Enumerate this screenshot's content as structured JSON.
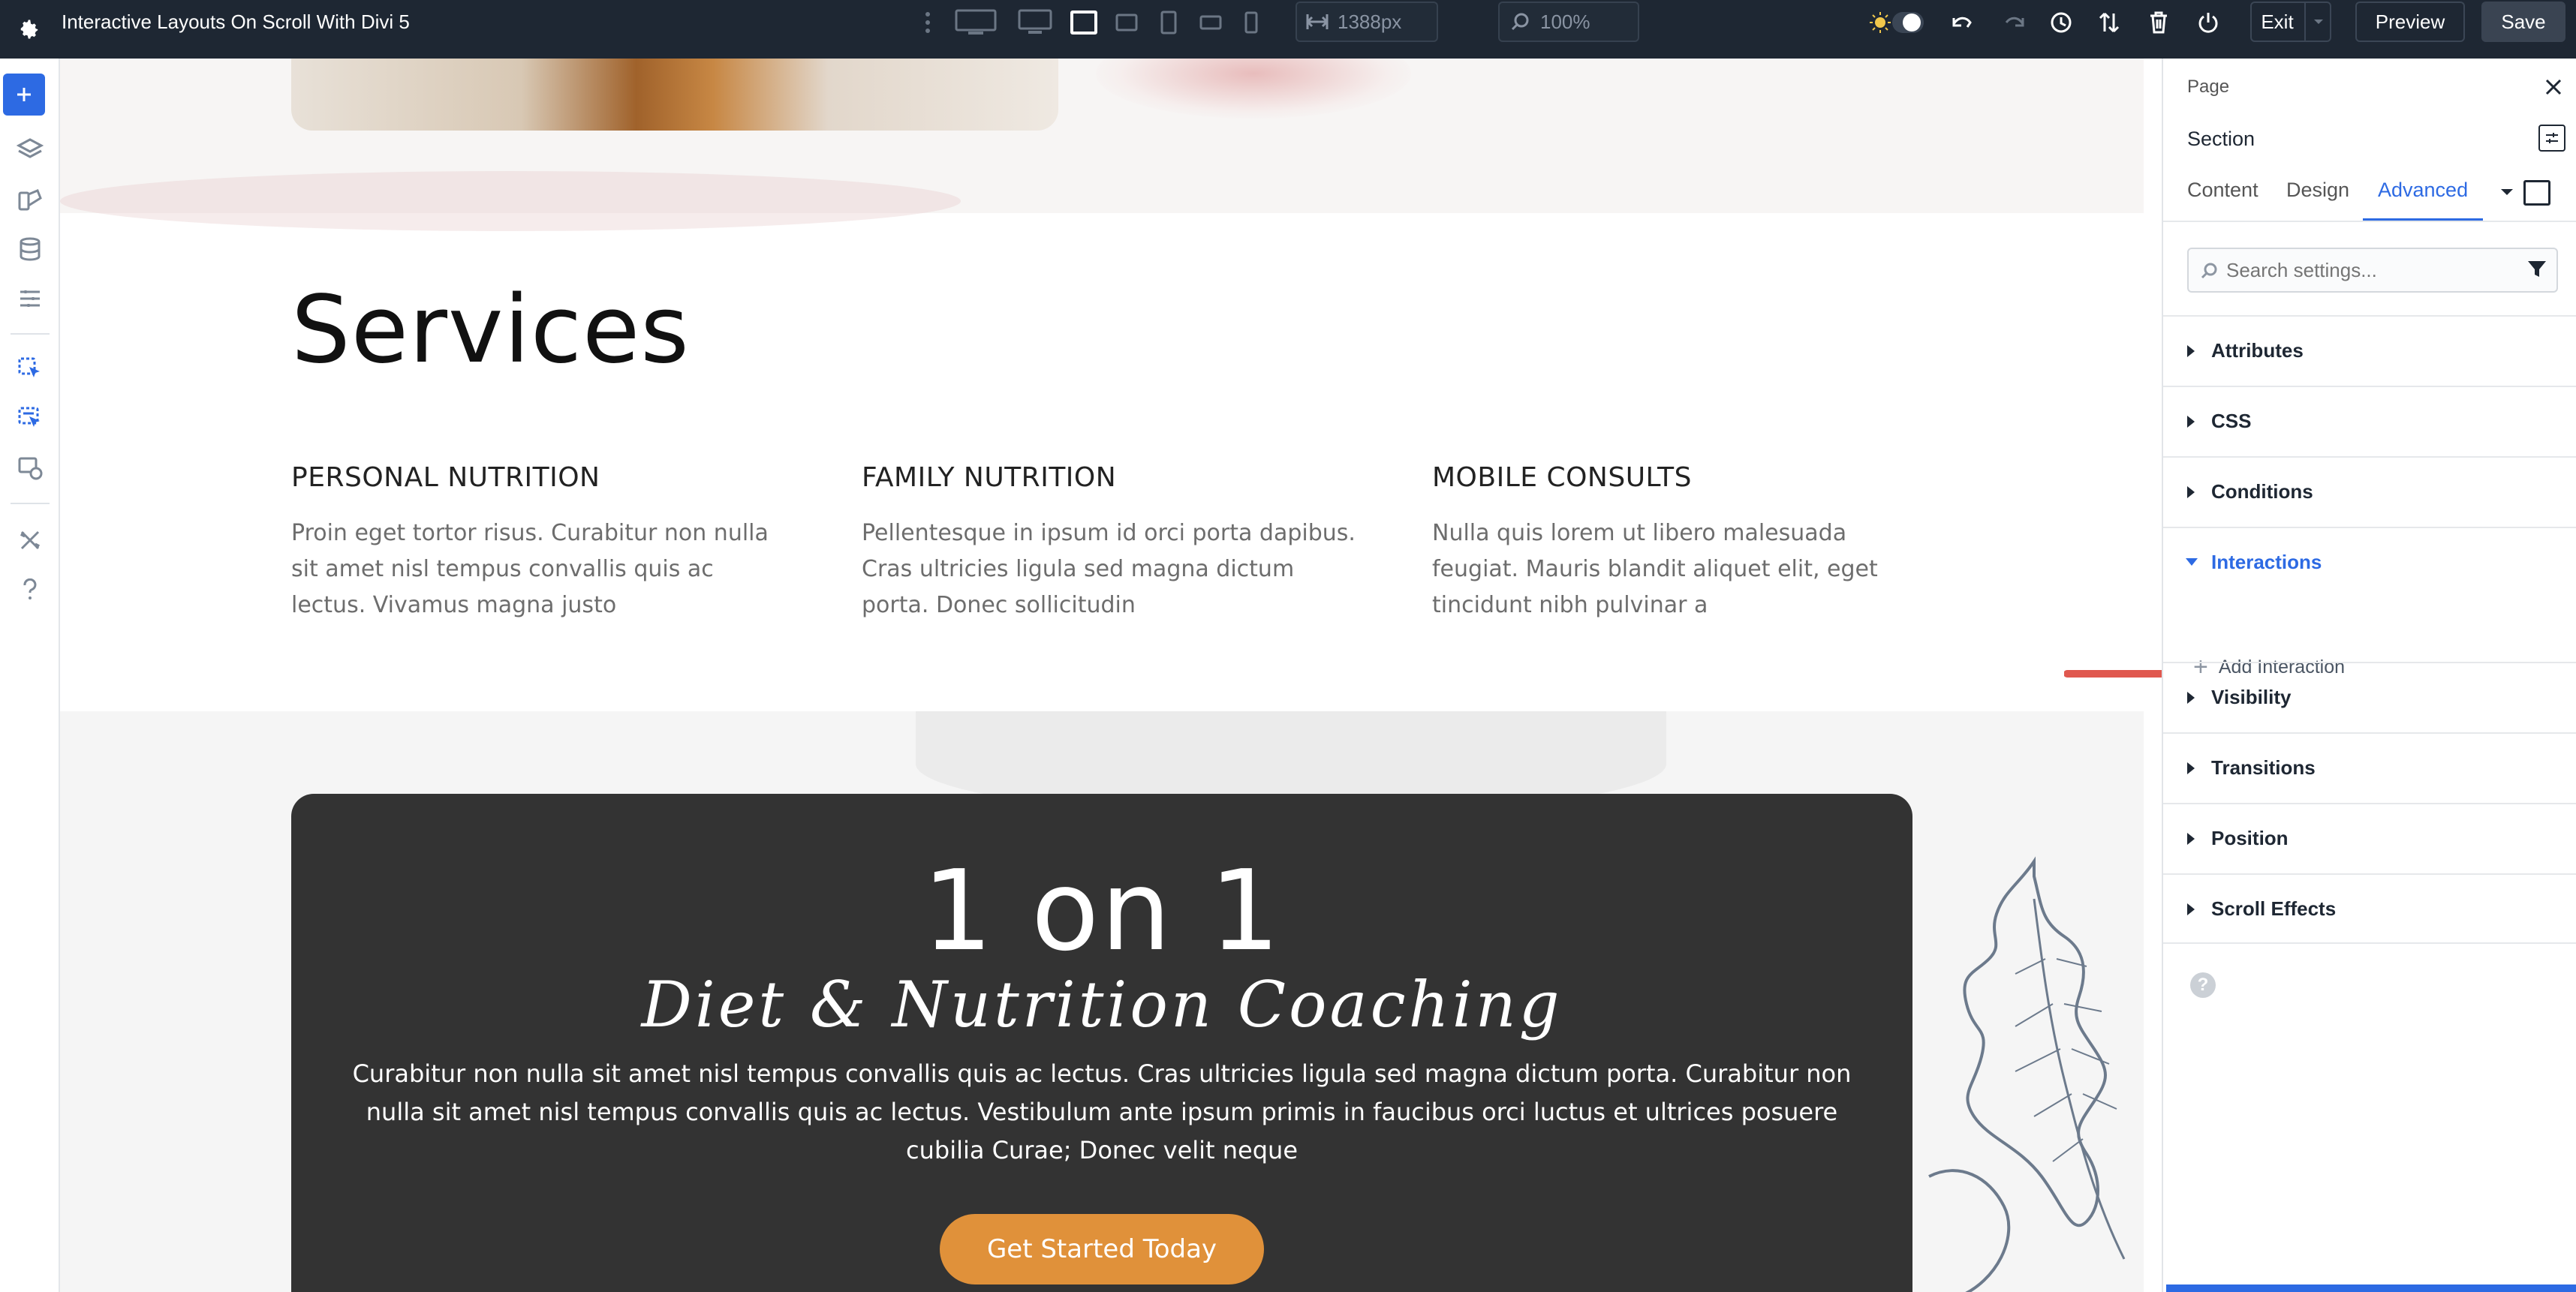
{
  "topbar": {
    "title": "Interactive Layouts On Scroll With Divi 5",
    "width_value": "1388px",
    "zoom_value": "100%",
    "exit_label": "Exit",
    "preview_label": "Preview",
    "save_label": "Save"
  },
  "canvas": {
    "services_title": "Services",
    "services": [
      {
        "heading": "PERSONAL NUTRITION",
        "text": "Proin eget tortor risus. Curabitur non nulla sit amet nisl tempus convallis quis ac lectus. Vivamus magna justo"
      },
      {
        "heading": "FAMILY NUTRITION",
        "text": "Pellentesque in ipsum id orci porta dapibus. Cras ultricies ligula sed magna dictum porta. Donec sollicitudin"
      },
      {
        "heading": "MOBILE CONSULTS",
        "text": "Nulla quis lorem ut libero malesuada feugiat. Mauris blandit aliquet elit, eget tincidunt nibh pulvinar a"
      }
    ],
    "card_heading": "1 on 1",
    "card_subheading": "Diet & Nutrition Coaching",
    "card_body": "Curabitur non nulla sit amet nisl tempus convallis quis ac lectus. Cras ultricies ligula sed magna dictum porta. Curabitur non nulla sit amet nisl tempus convallis quis ac lectus. Vestibulum ante ipsum primis in faucibus orci luctus et ultrices posuere cubilia Curae; Donec velit neque",
    "cta_label": "Get Started Today"
  },
  "panel": {
    "breadcrumb": "Page",
    "element_label": "Section",
    "tabs": [
      "Content",
      "Design",
      "Advanced"
    ],
    "active_tab": "Advanced",
    "search_placeholder": "Search settings...",
    "groups": [
      "Attributes",
      "CSS",
      "Conditions",
      "Interactions",
      "Visibility",
      "Transitions",
      "Position",
      "Scroll Effects"
    ],
    "open_group": "Interactions",
    "add_interaction_label": "Add Interaction"
  },
  "colors": {
    "accent": "#2d6ae3",
    "topbar_bg": "#1e2733",
    "card_bg": "#333333",
    "cta_bg": "#e0913a",
    "arrow": "#e0584f"
  }
}
